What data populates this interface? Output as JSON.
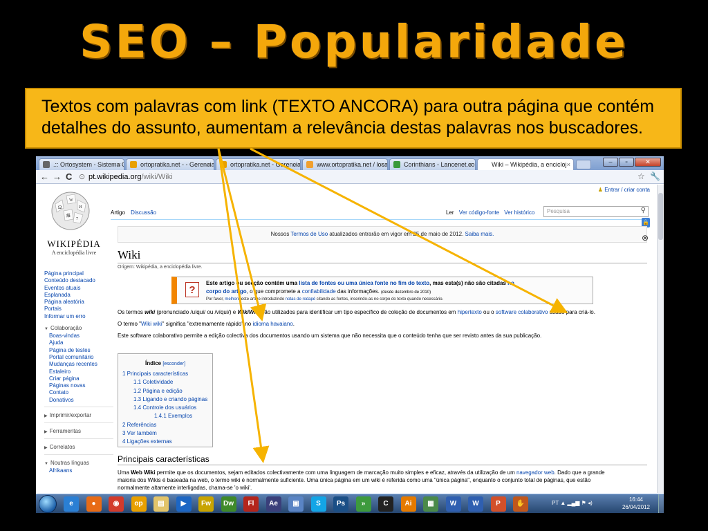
{
  "slide": {
    "title": "SEO – Popularidade",
    "callout": "Textos com palavras com link (TEXTO ANCORA) para outra página que contém detalhes do assunto, aumentam a relevância destas palavras nos buscadores."
  },
  "browser": {
    "tabs": [
      {
        "label": ".:: Ortosystem - Sistema O",
        "favicon_color": "#666666"
      },
      {
        "label": "ortopratika.net - - Gerencia",
        "favicon_color": "#e8a000"
      },
      {
        "label": "ortopratika.net - Gerenciad",
        "favicon_color": "#e8a000"
      },
      {
        "label": "www.ortopratika.net / local",
        "favicon_color": "#f0a030"
      },
      {
        "label": "Corinthians - Lancenet.com",
        "favicon_color": "#3a9a3a"
      },
      {
        "label": "Wiki – Wikipédia, a encicloj",
        "favicon_color": "#ffffff"
      }
    ],
    "url_domain": "pt.wikipedia.org",
    "url_path": "/wiki/Wiki"
  },
  "wiki": {
    "wordmark": "WIKIPÉDIA",
    "tagline": "A enciclopédia livre",
    "login": "Entrar / criar conta",
    "nav_links": [
      "Página principal",
      "Conteúdo destacado",
      "Eventos atuais",
      "Esplanada",
      "Página aleatória",
      "Portais",
      "Informar um erro"
    ],
    "colab_title": "Colaboração",
    "colab_links": [
      "Boas-vindas",
      "Ajuda",
      "Página de testes",
      "Portal comunitário",
      "Mudanças recentes",
      "Estaleiro",
      "Criar página",
      "Páginas novas",
      "Contato",
      "Donativos"
    ],
    "section_print": "Imprimir/exportar",
    "section_tools": "Ferramentas",
    "section_related": "Correlatos",
    "section_langs": "Noutras línguas",
    "lang_first": "Afrikaans",
    "tab_article": "Artigo",
    "tab_discussion": "Discussão",
    "tab_read": "Ler",
    "tab_source": "Ver código-fonte",
    "tab_history": "Ver histórico",
    "search_placeholder": "Pesquisa",
    "notice_pre": "Nossos ",
    "notice_link": "Termos de Uso",
    "notice_mid": " atualizados entrarão em vigor em 25 de maio de 2012. ",
    "notice_more": "Saiba mais.",
    "page_title": "Wiki",
    "origem": "Origem: Wikipédia, a enciclopédia livre.",
    "ambox_l1_pre": "Este artigo ou secção contém uma ",
    "ambox_l1_link": "lista de fontes ou uma única fonte no fim do texto",
    "ambox_l1_mid": ", mas esta(s) não são citadas ",
    "ambox_l1_link2": "no",
    "ambox_l2_link": "corpo do artigo",
    "ambox_l2_mid": ", o que compromete a ",
    "ambox_l2_link2": "confiabilidade",
    "ambox_l2_post": " das informações. ",
    "ambox_l2_date": "(desde dezembro de 2010)",
    "ambox_l3_pre": "Por favor, ",
    "ambox_l3_link": "melhore",
    "ambox_l3_mid": " este artigo introduzindo ",
    "ambox_l3_link2": "notas de rodapé",
    "ambox_l3_post": " citando as fontes, inserindo-as no corpo do texto quando necessário.",
    "p1_pre": "Os termos ",
    "p1_wiki": "wiki",
    "p1_mid": " (pronunciado /uíqui/ ou /víqui/) e ",
    "p1_wikiwiki": "WikiWiki",
    "p1_mid2": " são utilizados para identificar um tipo específico de coleção de documentos em ",
    "p1_link1": "hipertexto",
    "p1_mid3": " ou o ",
    "p1_link2": "software colaborativo",
    "p1_post": " usado para criá-lo.",
    "p2_pre": "O termo \"",
    "p2_link": "Wiki wiki",
    "p2_mid": "\" significa \"extremamente rápido\" no ",
    "p2_link2": "idioma havaiano",
    "p2_post": ".",
    "p3": "Este software colaborativo permite a edição colectiva dos documentos usando um sistema que não necessita que o conteúdo tenha que ser revisto antes da sua publicação.",
    "toc_title": "Índice",
    "toc_hide": "[esconder]",
    "toc": [
      {
        "label": "1 Principais características",
        "level": 1
      },
      {
        "label": "1.1 Coletividade",
        "level": 2
      },
      {
        "label": "1.2 Página e edição",
        "level": 2
      },
      {
        "label": "1.3 Ligando e criando páginas",
        "level": 2
      },
      {
        "label": "1.4 Controle dos usuários",
        "level": 2
      },
      {
        "label": "1.4.1 Exemplos",
        "level": 3
      },
      {
        "label": "2 Referências",
        "level": 1
      },
      {
        "label": "3 Ver também",
        "level": 1
      },
      {
        "label": "4 Ligações externas",
        "level": 1
      }
    ],
    "h2": "Principais características",
    "p4_pre": "Uma ",
    "p4_bold": "Web Wiki",
    "p4_mid": " permite que os documentos, sejam editados colectivamente com uma linguagem de marcação muito simples e eficaz, através da utilização de um ",
    "p4_link": "navegador web",
    "p4_post": ". Dado que a grande",
    "p5": "maioria dos Wikis é baseada na web, o termo wiki é normalmente suficiente. Uma única página em um wiki é referida como uma \"única página\", enquanto o conjunto total de páginas, que estão",
    "p6": "normalmente altamente interligadas, chama-se 'o wiki'."
  },
  "taskbar": {
    "tray_lang": "PT",
    "time": "16:44",
    "date": "26/04/2012",
    "apps": [
      {
        "name": "ie",
        "glyph": "e",
        "color": "#2a7fd4"
      },
      {
        "name": "firefox",
        "glyph": "●",
        "color": "#e86b16"
      },
      {
        "name": "chrome",
        "glyph": "◉",
        "color": "#d33b2c"
      },
      {
        "name": "ortopratika",
        "glyph": "op",
        "color": "#e8a000"
      },
      {
        "name": "explorer",
        "glyph": "▤",
        "color": "#e2c46a"
      },
      {
        "name": "media",
        "glyph": "▶",
        "color": "#1c66c4"
      },
      {
        "name": "fireworks",
        "glyph": "Fw",
        "color": "#c8a400"
      },
      {
        "name": "dreamweaver",
        "glyph": "Dw",
        "color": "#3f8a2a"
      },
      {
        "name": "flash",
        "glyph": "Fl",
        "color": "#b4251c"
      },
      {
        "name": "aftereffects",
        "glyph": "Ae",
        "color": "#3a3f7a"
      },
      {
        "name": "screen",
        "glyph": "▣",
        "color": "#5a84c4"
      },
      {
        "name": "skype",
        "glyph": "S",
        "color": "#13a5e6"
      },
      {
        "name": "photoshop",
        "glyph": "Ps",
        "color": "#1b4f86"
      },
      {
        "name": "arrow-app",
        "glyph": "»",
        "color": "#3d9a3d"
      },
      {
        "name": "colorpic",
        "glyph": "C",
        "color": "#222222"
      },
      {
        "name": "illustrator",
        "glyph": "Ai",
        "color": "#e57a00"
      },
      {
        "name": "utility",
        "glyph": "▦",
        "color": "#4a8a4a"
      },
      {
        "name": "word",
        "glyph": "W",
        "color": "#2f5fb0"
      },
      {
        "name": "word2",
        "glyph": "W",
        "color": "#2f5fb0"
      },
      {
        "name": "powerpoint",
        "glyph": "P",
        "color": "#d2502a"
      },
      {
        "name": "other",
        "glyph": "✋",
        "color": "#c0571d"
      }
    ]
  },
  "colors": {
    "title": "#f4a70b",
    "callout_bg": "#f7b718",
    "arrow": "#f6b300",
    "link": "#0645ad"
  }
}
